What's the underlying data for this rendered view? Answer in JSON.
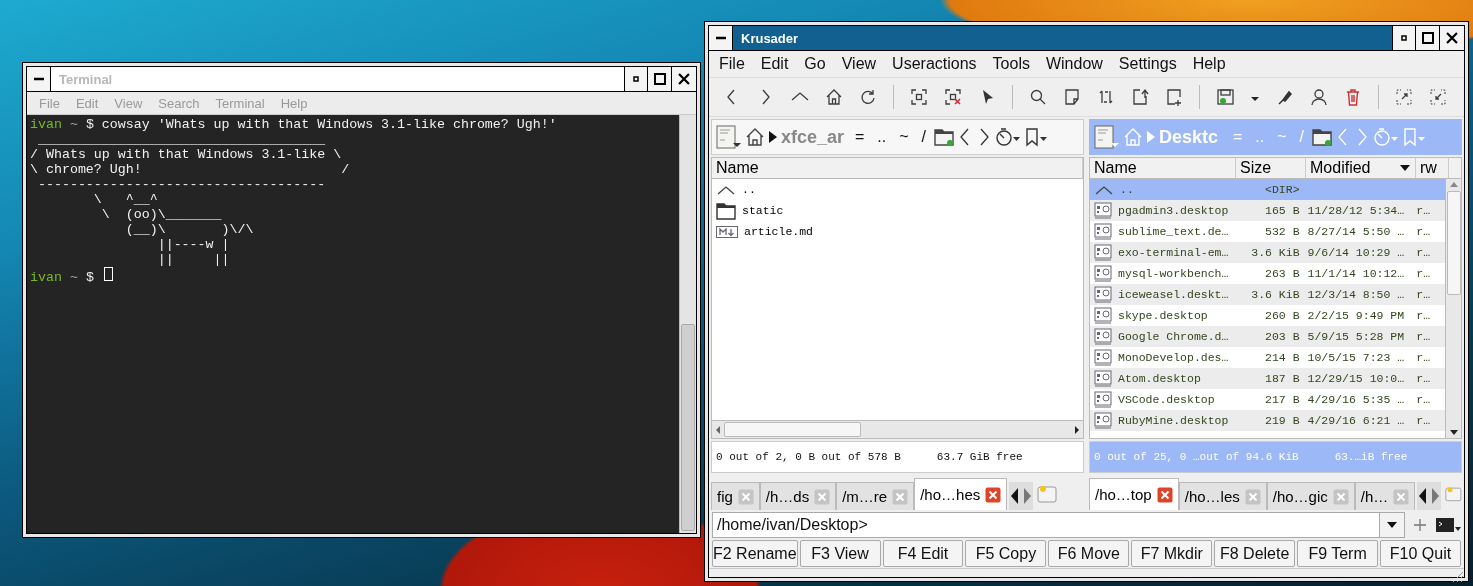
{
  "terminal": {
    "title": "Terminal",
    "menu": [
      "File",
      "Edit",
      "View",
      "Search",
      "Terminal",
      "Help"
    ],
    "lines": [
      {
        "kind": "prompt",
        "user": "ivan",
        "dir": "~",
        "symbol": "$",
        "command": "cowsay 'Whats up with that Windows 3.1-like chrome? Ugh!'"
      },
      {
        "kind": "text",
        "text": " ____________________________________"
      },
      {
        "kind": "text",
        "text": "/ Whats up with that Windows 3.1-like \\"
      },
      {
        "kind": "text",
        "text": "\\ chrome? Ugh!                         /"
      },
      {
        "kind": "text",
        "text": " ------------------------------------"
      },
      {
        "kind": "text",
        "text": "        \\   ^__^"
      },
      {
        "kind": "text",
        "text": "         \\  (oo)\\_______"
      },
      {
        "kind": "text",
        "text": "            (__)\\       )\\/\\"
      },
      {
        "kind": "text",
        "text": "                ||----w |"
      },
      {
        "kind": "text",
        "text": "                ||     ||"
      },
      {
        "kind": "prompt",
        "user": "ivan",
        "dir": "~",
        "symbol": "$",
        "cursor": true
      }
    ]
  },
  "krusader": {
    "title": "Krusader",
    "menu": [
      "File",
      "Edit",
      "Go",
      "View",
      "Useractions",
      "Tools",
      "Window",
      "Settings",
      "Help"
    ],
    "left_panel": {
      "active": false,
      "path": "xfce_ar",
      "crumbs": [
        "=",
        "..",
        "~",
        "/"
      ],
      "columns": [
        {
          "label": "Name",
          "sorted": false
        }
      ],
      "rows": [
        {
          "kind": "up",
          "name": "..",
          "selected": false
        },
        {
          "kind": "folder",
          "name": "static",
          "selected": false
        },
        {
          "kind": "markdown",
          "name": "article.md",
          "selected": false
        }
      ],
      "status": "0 out of 2, 0 B out of 578 B",
      "free": "63.7 GiB free",
      "tabs": [
        {
          "label": "fig",
          "selected": false
        },
        {
          "label": "/h…ds",
          "selected": false
        },
        {
          "label": "/m…re",
          "selected": false
        },
        {
          "label": "/ho…hes",
          "selected": true
        }
      ]
    },
    "right_panel": {
      "active": true,
      "path": "Desktc",
      "crumbs": [
        "=",
        "..",
        "~",
        "/"
      ],
      "columns": [
        {
          "label": "Name",
          "sorted": false
        },
        {
          "label": "Size",
          "sorted": false
        },
        {
          "label": "Modified",
          "sorted": true
        },
        {
          "label": "rw",
          "sorted": false
        }
      ],
      "rows": [
        {
          "kind": "up",
          "name": "..",
          "size": "<DIR>",
          "selected": true
        },
        {
          "kind": "desktop",
          "name": "pgadmin3.desktop",
          "size": "165 B",
          "modified": "11/28/12 5:34…",
          "rw": "r…",
          "selected": false
        },
        {
          "kind": "desktop",
          "name": "sublime_text.de…",
          "size": "532 B",
          "modified": "8/27/14 5:50 …",
          "rw": "r…",
          "selected": false
        },
        {
          "kind": "desktop",
          "name": "exo-terminal-em…",
          "size": "3.6 KiB",
          "modified": "9/6/14 10:29 …",
          "rw": "r…",
          "selected": false
        },
        {
          "kind": "desktop",
          "name": "mysql-workbench…",
          "size": "263 B",
          "modified": "11/1/14 10:12…",
          "rw": "r…",
          "selected": false
        },
        {
          "kind": "desktop",
          "name": "iceweasel.deskt…",
          "size": "3.6 KiB",
          "modified": "12/3/14 8:50 …",
          "rw": "r…",
          "selected": false
        },
        {
          "kind": "desktop",
          "name": "skype.desktop",
          "size": "260 B",
          "modified": "2/2/15 9:49 PM",
          "rw": "r…",
          "selected": false
        },
        {
          "kind": "desktop",
          "name": "Google Chrome.d…",
          "size": "203 B",
          "modified": "5/9/15 5:28 PM",
          "rw": "r…",
          "selected": false
        },
        {
          "kind": "desktop",
          "name": "MonoDevelop.des…",
          "size": "214 B",
          "modified": "10/5/15 7:23 …",
          "rw": "r…",
          "selected": false
        },
        {
          "kind": "desktop",
          "name": "Atom.desktop",
          "size": "187 B",
          "modified": "12/29/15 10:0…",
          "rw": "r…",
          "selected": false
        },
        {
          "kind": "desktop",
          "name": "VSCode.desktop",
          "size": "217 B",
          "modified": "4/29/16 5:35 …",
          "rw": "r…",
          "selected": false
        },
        {
          "kind": "desktop",
          "name": "RubyMine.desktop",
          "size": "219 B",
          "modified": "4/29/16 6:21 …",
          "rw": "r…",
          "selected": false
        }
      ],
      "status": "0 out of 25, 0 …out of 94.6 KiB",
      "free": "63.…iB free",
      "tabs": [
        {
          "label": "/ho…top",
          "selected": true
        },
        {
          "label": "/ho…les",
          "selected": false
        },
        {
          "label": "/ho…gic",
          "selected": false
        },
        {
          "label": "/h…",
          "selected": false
        }
      ]
    },
    "command_line": {
      "value": "/home/ivan/Desktop>"
    },
    "function_keys": [
      "F2 Rename",
      "F3 View",
      "F4 Edit",
      "F5 Copy",
      "F6 Move",
      "F7 Mkdir",
      "F8 Delete",
      "F9 Term",
      "F10 Quit"
    ]
  }
}
